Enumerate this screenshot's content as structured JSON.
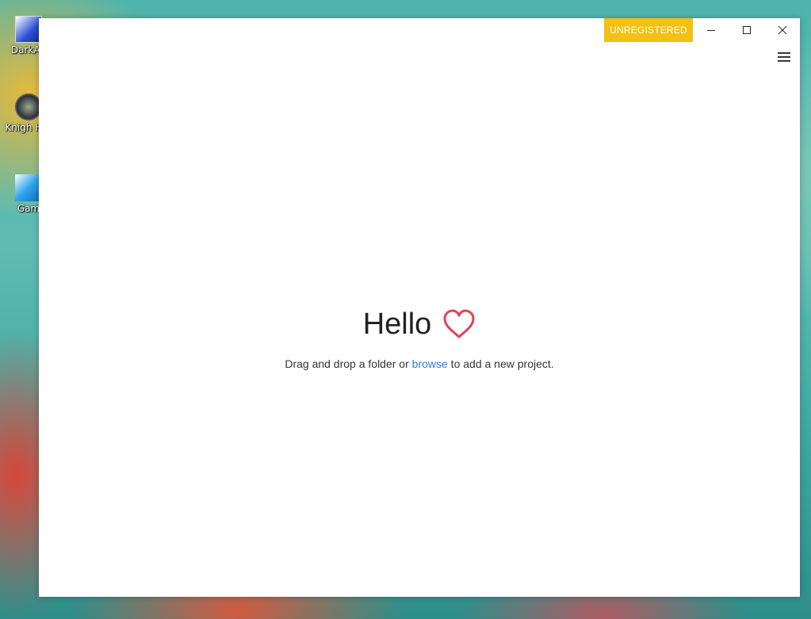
{
  "desktop": {
    "icons": [
      {
        "label": "DarkAg",
        "icon": "app-icon"
      },
      {
        "label": "Knigh Hor",
        "icon": "shortcut-icon"
      },
      {
        "label": "Gam",
        "icon": "app-icon"
      }
    ]
  },
  "window": {
    "badge": "UNREGISTERED",
    "controls": {
      "minimize": "minimize-icon",
      "maximize": "maximize-icon",
      "close": "close-icon"
    },
    "menu_icon": "hamburger-menu-icon"
  },
  "welcome": {
    "greeting": "Hello",
    "heart_icon": "heart-icon",
    "prefix": "Drag and drop a folder or ",
    "link": "browse",
    "suffix": " to add a new project."
  },
  "colors": {
    "badge": "#f3c014",
    "heart": "#e0435a",
    "link": "#2f7bd8"
  }
}
